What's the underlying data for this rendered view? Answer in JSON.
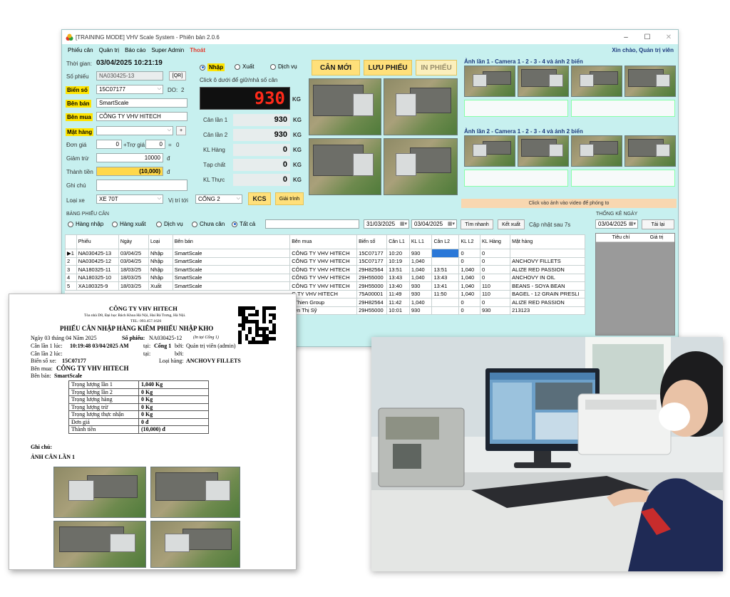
{
  "window": {
    "title": "[TRAINING MODE] VHV Scale System - Phiên bản 2.0.6",
    "menu": [
      "Phiếu cân",
      "Quản trị",
      "Báo cáo",
      "Super Admin",
      "Thoát"
    ],
    "greeting": "Xin chào, Quản trị viên",
    "controls": [
      "–",
      "☐",
      "✕"
    ]
  },
  "form": {
    "thoi_gian_label": "Thời gian:",
    "thoi_gian_value": "03/04/2025 10:21:19",
    "so_phieu_label": "Số phiếu",
    "so_phieu_value": "NA030425-13",
    "qr_button": "[QR]",
    "bien_so_label": "Biển số",
    "bien_so_value": "15C07177",
    "do_label": "DO:",
    "do_value": "2",
    "ben_ban_label": "Bên bán",
    "ben_ban_value": "SmartScale",
    "ben_mua_label": "Bên mua",
    "ben_mua_value": "CÔNG TY VHV HITECH",
    "mat_hang_label": "Mặt hàng",
    "mat_hang_value": "",
    "add_button": "+",
    "don_gia_label": "Đơn giá",
    "don_gia_value": "0",
    "tro_gia_label": "+Trợ giá",
    "tro_gia_value": "0",
    "equals": "=",
    "don_gia_total": "0",
    "giam_tru_label": "Giảm trừ",
    "giam_tru_value": "10000",
    "giam_tru_unit": "đ",
    "thanh_tien_label": "Thành tiền",
    "thanh_tien_value": "(10,000)",
    "thanh_tien_unit": "đ",
    "ghi_chu_label": "Ghi chú",
    "ghi_chu_value": "",
    "loai_xe_label": "Loại xe",
    "loai_xe_value": "XE 70T",
    "vi_tri_label": "Vị trí tới",
    "vi_tri_value": "CỔNG 2",
    "kcs_button": "KCS",
    "giai_trinh_button": "Giải trình"
  },
  "mode": {
    "options": [
      "Nhập",
      "Xuất",
      "Dịch vụ"
    ],
    "selected": "Nhập",
    "hint": "Click ô dưới để giữ/nhả số cân"
  },
  "scale": {
    "display": "930",
    "unit": "KG",
    "rows": [
      {
        "label": "Cân lần 1",
        "value": "930",
        "unit": "KG"
      },
      {
        "label": "Cân lần 2",
        "value": "930",
        "unit": "KG"
      },
      {
        "label": "KL Hàng",
        "value": "0",
        "unit": "KG"
      },
      {
        "label": "Tạp chất",
        "value": "0",
        "unit": "KG"
      },
      {
        "label": "KL Thực",
        "value": "0",
        "unit": "KG"
      }
    ]
  },
  "actions": {
    "new": "CÂN MỚI",
    "save": "LƯU PHIẾU",
    "print": "IN PHIẾU"
  },
  "camera": {
    "title1": "Ảnh lần 1 - Camera 1 - 2 - 3 - 4 và ảnh 2 biển",
    "title2": "Ảnh lần 2 - Camera 1 - 2 - 3 - 4 và ảnh 2 biển",
    "zoom_hint": "Click vào ảnh vào video để phóng to"
  },
  "table": {
    "title": "BẢNG PHIẾU CÂN",
    "filters": [
      "Hàng nhập",
      "Hàng xuất",
      "Dịch vụ",
      "Chưa cân",
      "Tất cả"
    ],
    "selected_filter": "Tất cả",
    "search_value": "",
    "date_from": "31/03/2025",
    "date_to": "03/04/2025",
    "search_button": "Tìm nhanh",
    "export_button": "Kết xuất",
    "refresh_text": "Cập nhật sau 7s",
    "columns": [
      "",
      "Phiếu",
      "Ngày",
      "Loại",
      "Bên bán",
      "Bên mua",
      "Biển số",
      "Cân L1",
      "KL L1",
      "Cân L2",
      "KL L2",
      "KL Hàng",
      "Mặt hàng"
    ],
    "rows": [
      [
        "▶1",
        "NA030425-13",
        "03/04/25",
        "Nhập",
        "SmartScale",
        "CÔNG TY VHV HITECH",
        "15C07177",
        "10:20",
        "930",
        "",
        "0",
        "0",
        ""
      ],
      [
        "2",
        "NA030425-12",
        "03/04/25",
        "Nhập",
        "SmartScale",
        "CÔNG TY VHV HITECH",
        "15C07177",
        "10:19",
        "1,040",
        "",
        "0",
        "0",
        "ANCHOVY FILLETS"
      ],
      [
        "3",
        "NA180325-11",
        "18/03/25",
        "Nhập",
        "SmartScale",
        "CÔNG TY VHV HITECH",
        "29H82564",
        "13:51",
        "1,040",
        "13:51",
        "1,040",
        "0",
        "ALIZE RED PASSION"
      ],
      [
        "4",
        "NA180325-10",
        "18/03/25",
        "Nhập",
        "SmartScale",
        "CÔNG TY VHV HITECH",
        "29H55000",
        "13:43",
        "1,040",
        "13:43",
        "1,040",
        "0",
        "ANCHOVY IN OIL"
      ],
      [
        "5",
        "XA180325-9",
        "18/03/25",
        "Xuất",
        "SmartScale",
        "CÔNG TY VHV HITECH",
        "29H55000",
        "13:40",
        "930",
        "13:41",
        "1,040",
        "110",
        "BEANS - SOYA BEAN"
      ],
      [
        "",
        "",
        "",
        "",
        "",
        "G TY VHV HITECH",
        "75A00001",
        "11:49",
        "930",
        "11:50",
        "1,040",
        "110",
        "BAGEL - 12 GRAIN PRESLI"
      ],
      [
        "",
        "",
        "",
        "",
        "",
        "nThien Group",
        "29H82564",
        "11:42",
        "1,040",
        "",
        "0",
        "0",
        "ALIZE RED PASSION"
      ],
      [
        "",
        "",
        "",
        "",
        "",
        "yễn Thị Sỹ",
        "29H55000",
        "10:01",
        "930",
        "",
        "0",
        "930",
        "213123"
      ]
    ]
  },
  "stats": {
    "title": "THỐNG KÊ NGÀY",
    "date": "03/04/2025",
    "reload_button": "Tải lại",
    "columns": [
      "Tiêu chí",
      "Giá trị"
    ]
  },
  "document": {
    "company": "CÔNG TY VHV HITECH",
    "address": "Tòa nhà D8, Đại học Bách Khoa Hà Nội, Hai Bà Trưng, Hà Nội.",
    "tel": "TEL: 093.457.1626",
    "heading": "PHIẾU CÂN NHẬP HÀNG KIÊM PHIẾU NHẬP KHO",
    "date_line": "Ngày 03  tháng 04  Năm  2025",
    "so_phieu_label": "Số phiếu:",
    "so_phieu_value": "NA030425-12",
    "in_tai": "(In tại Cổng 1)",
    "can_lan1": "Cân lần 1 lúc:",
    "can_lan1_time": "10:19:48 03/04/2025 AM",
    "tai_label": "tại:",
    "tai_value": "Cổng 1",
    "boi_label": "bởi:",
    "boi_value": "Quản trị viên (admin)",
    "can_lan2": "Cân lần 2 lúc:",
    "tai2": "tại:",
    "boi2": "bởi:",
    "bien_so_label": "Biển số xe:",
    "bien_so_value": "15C07177",
    "loai_hang_label": "Loại hàng:",
    "loai_hang_value": "ANCHOVY FILLETS",
    "ben_mua_label": "Bên mua:",
    "ben_mua_value": "CÔNG TY VHV HITECH",
    "ben_ban_label": "Bên bán:",
    "ben_ban_value": "SmartScale",
    "rows": [
      [
        "Trọng lượng lần 1",
        "1,040 Kg"
      ],
      [
        "Trọng lượng lần 2",
        "0 Kg"
      ],
      [
        "Trọng lượng hàng",
        "0 Kg"
      ],
      [
        "Trọng lượng trừ",
        "0 Kg"
      ],
      [
        "Trọng lượng thực nhận",
        "0 Kg"
      ],
      [
        "Đơn giá",
        "0 đ"
      ],
      [
        "Thành tiền",
        "(10,000) đ"
      ]
    ],
    "ghi_chu": "Ghi chú:",
    "anh_can": "ẢNH CÂN LẦN 1"
  },
  "colors": {
    "window_bg": "#c7f0ef",
    "yellow": "#ffe400",
    "display_red": "#ff2a1a",
    "menu_red": "#e23b2e"
  }
}
